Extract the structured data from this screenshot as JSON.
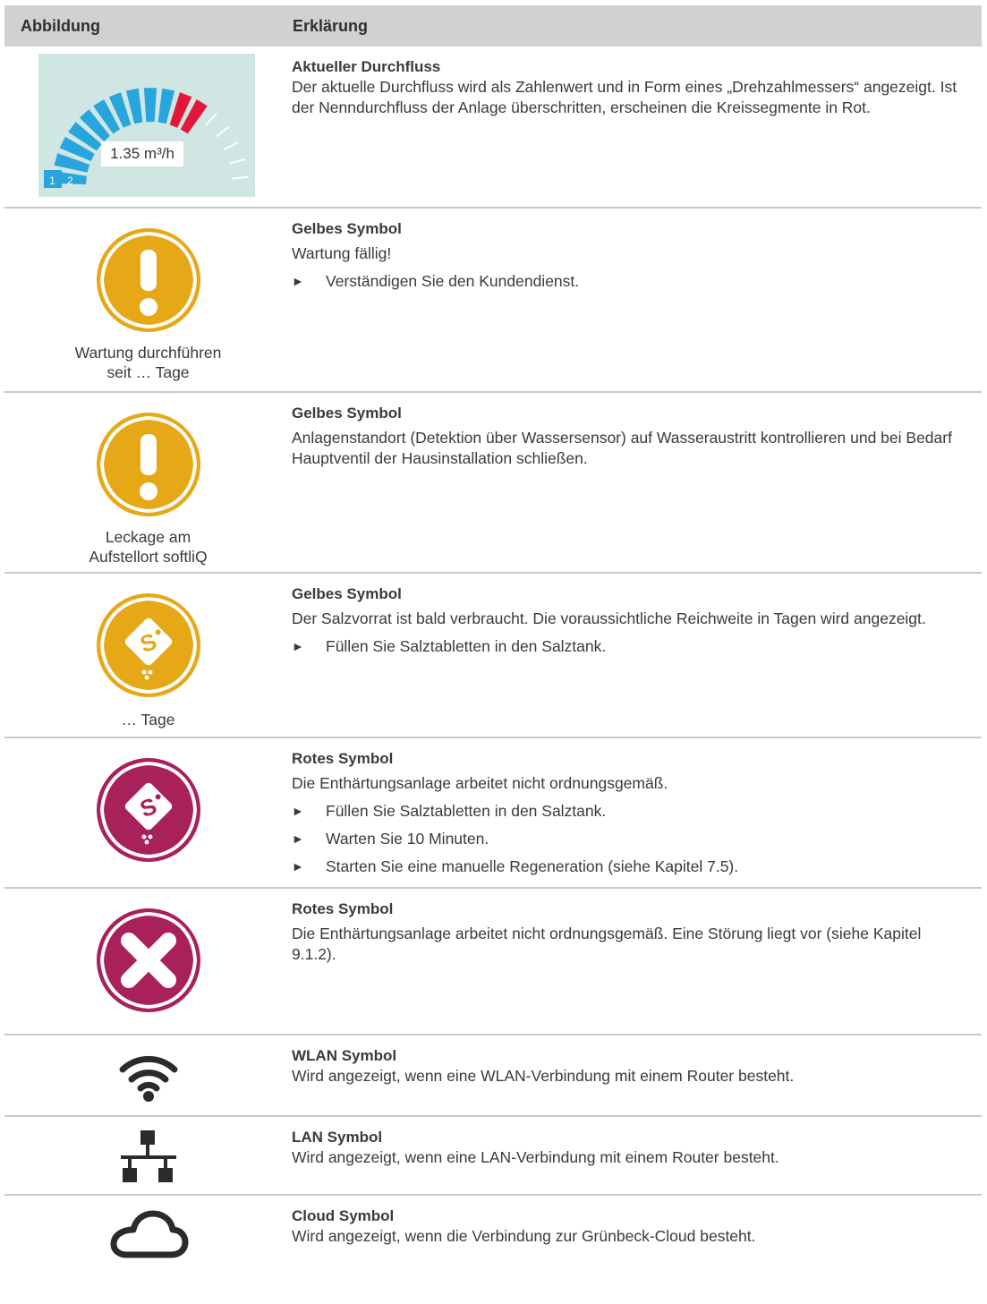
{
  "header": {
    "col1": "Abbildung",
    "col2": "Erklärung"
  },
  "gauge": {
    "value_text": "1.35 m³/h",
    "num1": "1",
    "num2": "2",
    "blue": "#29a5dd",
    "red": "#e2173a"
  },
  "rows": [
    {
      "title": "Aktueller Durchfluss",
      "text": "Der aktuelle Durchfluss wird als Zahlenwert und in Form eines „Drehzahlmessers“ angezeigt. Ist der Nenndurchfluss der Anlage überschritten, erscheinen die Kreissegmente in Rot."
    },
    {
      "title": "Gelbes Symbol",
      "text": "Wartung fällig!",
      "bullets": [
        "Verständigen Sie den Kundendienst."
      ],
      "caption1": "Wartung durchführen",
      "caption2": "seit … Tage",
      "icon": "exclamation-icon"
    },
    {
      "title": "Gelbes Symbol",
      "text": "Anlagenstandort (Detektion über Wassersensor) auf Wasseraustritt kontrollieren und bei Bedarf Hauptventil der Hausinstallation schließen.",
      "caption1": "Leckage am",
      "caption2": "Aufstellort softliQ",
      "icon": "exclamation-icon"
    },
    {
      "title": "Gelbes Symbol",
      "text": "Der Salzvorrat ist bald verbraucht. Die voraussichtliche Reichweite in Tagen wird angezeigt.",
      "bullets": [
        "Füllen Sie Salztabletten in den Salztank."
      ],
      "caption1": "… Tage",
      "icon": "salt-icon"
    },
    {
      "title": "Rotes Symbol",
      "text": "Die Enthärtungsanlage arbeitet nicht ordnungsgemäß.",
      "bullets": [
        "Füllen Sie Salztabletten in den Salztank.",
        "Warten Sie 10 Minuten.",
        "Starten Sie eine manuelle Regeneration (siehe Kapitel 7.5)."
      ],
      "icon": "salt-icon"
    },
    {
      "title": "Rotes Symbol",
      "text": "Die Enthärtungsanlage arbeitet nicht ordnungsgemäß. Eine Störung liegt vor (siehe Kapitel 9.1.2).",
      "icon": "error-x-icon"
    },
    {
      "title": "WLAN Symbol",
      "text": "Wird angezeigt, wenn eine WLAN-Verbindung mit einem Router besteht.",
      "icon": "wifi-icon"
    },
    {
      "title": "LAN Symbol",
      "text": "Wird angezeigt, wenn eine LAN-Verbindung mit einem Router besteht.",
      "icon": "lan-icon"
    },
    {
      "title": "Cloud Symbol",
      "text": "Wird angezeigt, wenn die Verbindung zur Grünbeck-Cloud besteht.",
      "icon": "cloud-icon"
    }
  ],
  "colors": {
    "yellow": "#e6a817",
    "yellow_dark": "#c98d09",
    "magenta": "#a8215a",
    "magenta_dark": "#7f1743",
    "header_bg": "#d1d1d1"
  }
}
